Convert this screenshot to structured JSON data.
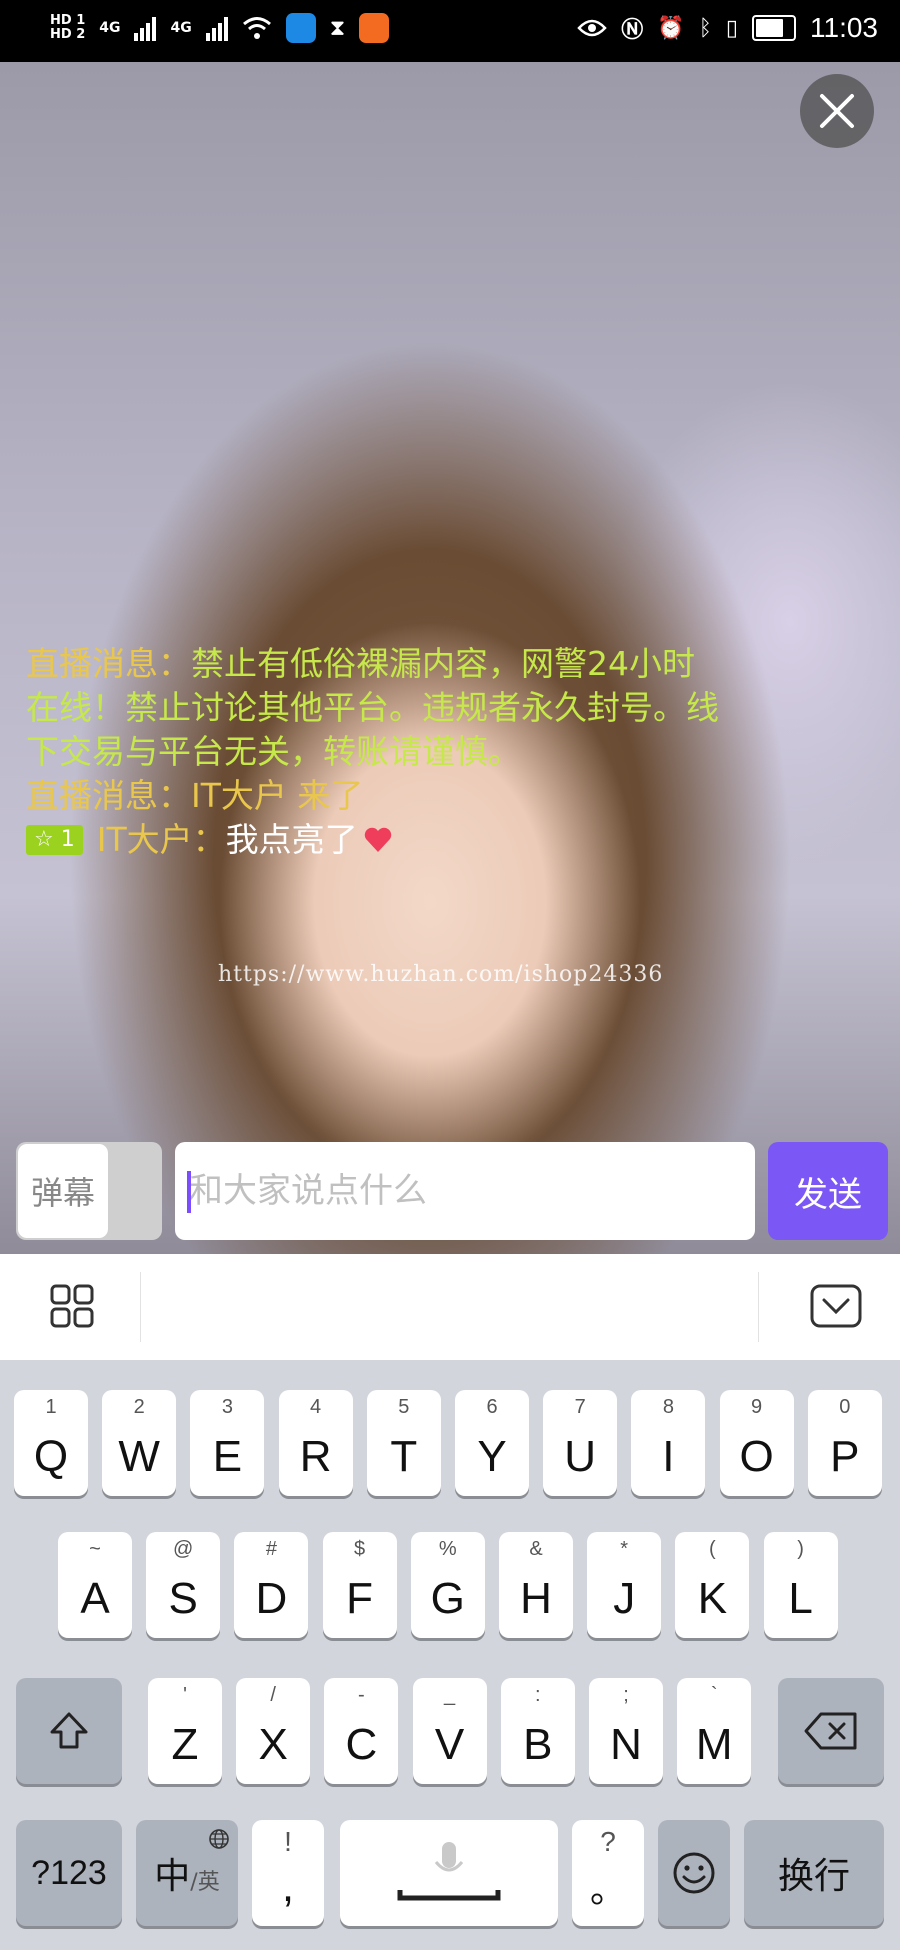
{
  "status_bar": {
    "hd1": "HD 1",
    "hd2": "HD 2",
    "net1": "4G",
    "net2": "4G",
    "time": "11:03",
    "battery_percent": 80
  },
  "live": {
    "messages": [
      {
        "label": "直播消息：",
        "text": "禁止有低俗裸漏内容，网警24小时在线！禁止讨论其他平台。违规者永久封号。线下交易与平台无关，转账请谨慎。"
      },
      {
        "label": "直播消息：",
        "text": "IT大户 来了"
      }
    ],
    "user_message": {
      "badge": "☆ 1",
      "name": "IT大户：",
      "text": "我点亮了"
    },
    "watermark": "https://www.huzhan.com/ishop24336"
  },
  "input_bar": {
    "danmu_label": "弹幕",
    "placeholder": "和大家说点什么",
    "send_label": "发送"
  },
  "keyboard": {
    "row1": [
      {
        "hint": "1",
        "key": "Q"
      },
      {
        "hint": "2",
        "key": "W"
      },
      {
        "hint": "3",
        "key": "E"
      },
      {
        "hint": "4",
        "key": "R"
      },
      {
        "hint": "5",
        "key": "T"
      },
      {
        "hint": "6",
        "key": "Y"
      },
      {
        "hint": "7",
        "key": "U"
      },
      {
        "hint": "8",
        "key": "I"
      },
      {
        "hint": "9",
        "key": "O"
      },
      {
        "hint": "0",
        "key": "P"
      }
    ],
    "row2": [
      {
        "hint": "~",
        "key": "A"
      },
      {
        "hint": "@",
        "key": "S"
      },
      {
        "hint": "#",
        "key": "D"
      },
      {
        "hint": "$",
        "key": "F"
      },
      {
        "hint": "%",
        "key": "G"
      },
      {
        "hint": "&",
        "key": "H"
      },
      {
        "hint": "*",
        "key": "J"
      },
      {
        "hint": "(",
        "key": "K"
      },
      {
        "hint": ")",
        "key": "L"
      }
    ],
    "row3": [
      {
        "hint": "'",
        "key": "Z"
      },
      {
        "hint": "/",
        "key": "X"
      },
      {
        "hint": "-",
        "key": "C"
      },
      {
        "hint": "_",
        "key": "V"
      },
      {
        "hint": ":",
        "key": "B"
      },
      {
        "hint": ";",
        "key": "N"
      },
      {
        "hint": "`",
        "key": "M"
      }
    ],
    "num_label": "?123",
    "lang_label": "中",
    "lang_sub": "/英",
    "punct_hint": "!",
    "punct_key": ",",
    "punct2_hint": "?",
    "punct2_key": "。",
    "enter_label": "换行"
  },
  "colors": {
    "accent": "#7b57f5",
    "system_label": "#e9c74d",
    "system_text": "#c6e84a",
    "badge": "#9bd21f"
  },
  "icons": [
    "close-icon",
    "grid-icon",
    "hide-keyboard-icon",
    "shift-icon",
    "backspace-icon",
    "globe-icon",
    "mic-icon",
    "emoji-icon",
    "heart-icon"
  ]
}
